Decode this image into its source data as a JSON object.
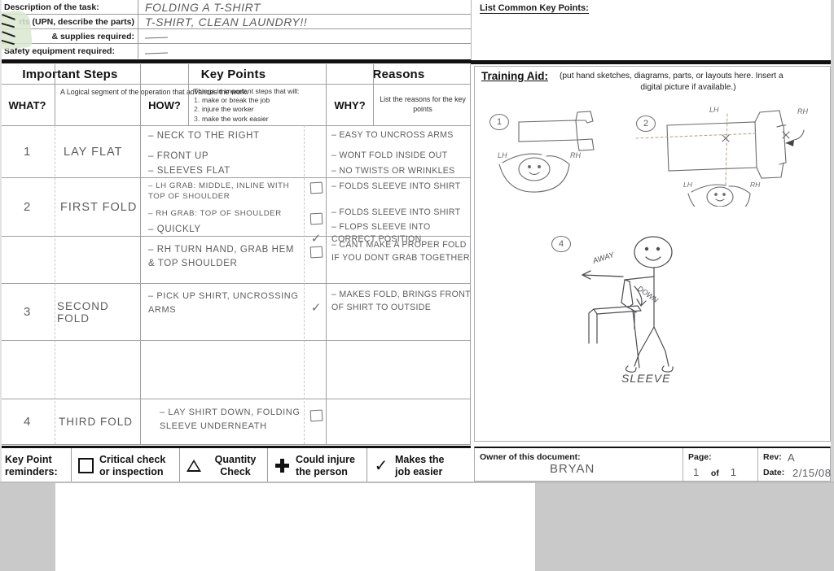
{
  "header_fields": [
    {
      "label": "Description of the task:",
      "value": "FOLDING A   T-SHIRT",
      "align": "left"
    },
    {
      "label": "rts (UPN, describe the parts)",
      "value": "T-SHIRT,  CLEAN LAUNDRY!!",
      "align": "right"
    },
    {
      "label": "& supplies required:",
      "value": "",
      "align": "right",
      "dash": true
    },
    {
      "label": "Safety equipment required:",
      "value": "",
      "align": "left",
      "dash": true
    }
  ],
  "columns": {
    "important_steps": "Important Steps",
    "key_points": "Key Points",
    "reasons": "Reasons",
    "what": "WHAT?",
    "what_desc": "A Logical segment of the operation that advances the work.",
    "how": "HOW?",
    "how_desc_title": "Things in important steps that will:",
    "how_desc_items": [
      "make or break the job",
      "injure the worker",
      "make the work easier"
    ],
    "why": "WHY?",
    "why_desc": "List the reasons for the key points"
  },
  "rows": [
    {
      "num": "1",
      "step": "LAY FLAT",
      "key_points": [
        "– NECK TO THE RIGHT",
        "– FRONT UP",
        "– SLEEVES FLAT"
      ],
      "symbols": [],
      "reasons": [
        "– EASY TO UNCROSS ARMS",
        "– WONT FOLD INSIDE OUT",
        "– NO TWISTS OR WRINKLES"
      ]
    },
    {
      "num": "2",
      "step": "FIRST FOLD",
      "key_points": [
        "– LH GRAB: MIDDLE, INLINE WITH TOP OF SHOULDER",
        "– RH GRAB: TOP OF SHOULDER",
        "– QUICKLY"
      ],
      "symbols": [
        "square",
        "square",
        "check"
      ],
      "reasons": [
        "– FOLDS SLEEVE INTO SHIRT",
        "– FOLDS SLEEVE INTO SHIRT",
        "– FLOPS SLEEVE INTO CORRECT POSITION"
      ]
    },
    {
      "num": "",
      "step": "",
      "key_points": [
        "– RH TURN HAND, GRAB HEM & TOP SHOULDER"
      ],
      "symbols": [
        "square"
      ],
      "reasons": [
        "– CANT MAKE A PROPER FOLD IF YOU DONT GRAB TOGETHER"
      ]
    },
    {
      "num": "3",
      "step": "SECOND FOLD",
      "key_points": [
        "– PICK UP SHIRT, UNCROSSING ARMS"
      ],
      "symbols": [
        "check"
      ],
      "reasons": [
        "– MAKES FOLD, BRINGS FRONT OF SHIRT TO OUTSIDE"
      ]
    },
    {
      "num": "4",
      "step": "THIRD FOLD",
      "key_points": [
        "– LAY SHIRT DOWN, FOLDING SLEEVE UNDERNEATH"
      ],
      "symbols": [
        "square"
      ],
      "reasons": []
    },
    {
      "num": "",
      "step": "",
      "key_points": [],
      "symbols": [],
      "reasons": []
    }
  ],
  "legend": {
    "title_line1": "Key Point",
    "title_line2": "reminders:",
    "items": [
      {
        "icon": "square-icon",
        "line1": "Critical check",
        "line2": "or inspection"
      },
      {
        "icon": "triangle-icon",
        "line1": "Quantity",
        "line2": "Check"
      },
      {
        "icon": "plus-icon",
        "line1": "Could injure",
        "line2": "the person"
      },
      {
        "icon": "checkmark-icon",
        "line1": "Makes the",
        "line2": "job easier"
      }
    ]
  },
  "right_panel": {
    "common_key_points_label": "List Common Key Points:",
    "training_aid_title": "Training Aid:",
    "training_aid_sub_line1": "(put hand sketches, diagrams, parts, or layouts here. Insert a",
    "training_aid_sub_line2": "digital picture if available.)",
    "sketches": [
      {
        "num": "1",
        "labels": [
          "LH",
          "RH"
        ]
      },
      {
        "num": "2",
        "labels": [
          "LH",
          "RH",
          "LH",
          "RH"
        ]
      },
      {
        "num": "4",
        "labels": [
          "AWAY",
          "DOWN",
          "SLEEVE"
        ]
      }
    ]
  },
  "footer": {
    "owner_label": "Owner of this document:",
    "owner_value": "BRYAN",
    "page_label": "Page:",
    "page_value": "1",
    "page_of": "of",
    "page_total": "1",
    "rev_label": "Rev:",
    "rev_value": "A",
    "date_label": "Date:",
    "date_value": "2/15/08"
  },
  "colors": {
    "ink": "#5d5d61",
    "print": "#111111",
    "rule": "#9fa0a3",
    "sticky": "#d9e7cf"
  }
}
